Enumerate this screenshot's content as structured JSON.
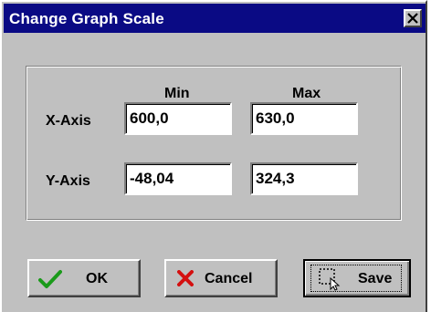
{
  "dialog": {
    "title": "Change Graph Scale",
    "close_icon": "close-icon"
  },
  "columns": {
    "min_label": "Min",
    "max_label": "Max"
  },
  "rows": [
    {
      "label": "X-Axis",
      "min": "600,0",
      "max": "630,0"
    },
    {
      "label": "Y-Axis",
      "min": "-48,04",
      "max": "324,3"
    }
  ],
  "buttons": {
    "ok": {
      "label": "OK",
      "icon": "checkmark-icon"
    },
    "cancel": {
      "label": "Cancel",
      "icon": "red-x-icon"
    },
    "save": {
      "label": "Save",
      "icon": "save-selection-icon"
    }
  },
  "colors": {
    "titlebar": "#0a0a84",
    "dialog_bg": "#c0c0c0",
    "check_green": "#1a9a1a",
    "cancel_red": "#d41010"
  }
}
